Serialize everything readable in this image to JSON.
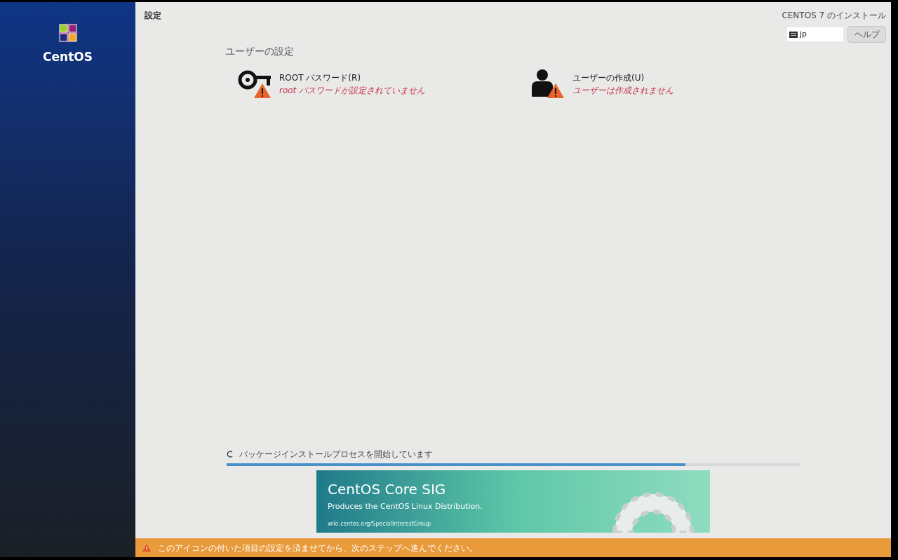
{
  "sidebar": {
    "logo_text": "CentOS"
  },
  "header": {
    "title": "設定",
    "product": "CENTOS 7 のインストール",
    "keyboard_layout": "jp",
    "help_button": "ヘルプ"
  },
  "section": {
    "title": "ユーザーの設定"
  },
  "spokes": [
    {
      "kind": "key",
      "title": "ROOT パスワード(R)",
      "status": "root パスワードが設定されていません",
      "warning": true
    },
    {
      "kind": "user",
      "title": "ユーザーの作成(U)",
      "status": "ユーザーは作成されません",
      "warning": true
    }
  ],
  "progress": {
    "label": "パッケージインストールプロセスを開始しています",
    "level": 0.8
  },
  "banner": {
    "title": "CentOS Core SIG",
    "subtitle": "Produces the CentOS Linux Distribution.",
    "url": "wiki.centos.org/SpecialInterestGroup"
  },
  "warning_bar": {
    "text": "このアイコンの付いた項目の設定を済ませてから、次のステップへ進んでください。"
  }
}
